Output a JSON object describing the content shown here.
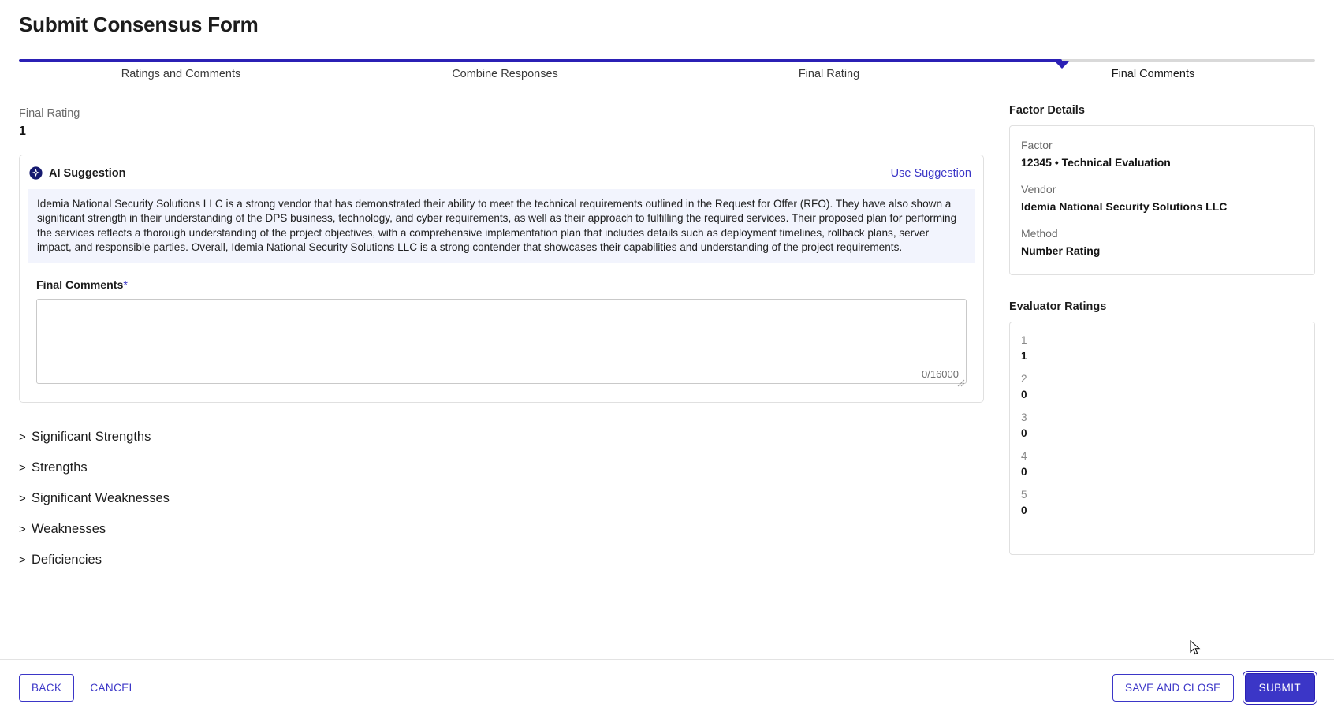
{
  "header": {
    "title": "Submit Consensus Form"
  },
  "stepper": {
    "steps": [
      {
        "label": "Ratings and Comments"
      },
      {
        "label": "Combine Responses"
      },
      {
        "label": "Final Rating"
      },
      {
        "label": "Final Comments"
      }
    ],
    "active_index": 3,
    "fill_percent": 80.5,
    "marker_percent": 80.5,
    "accent_color": "#2b20b5",
    "track_color": "#d9d9d9"
  },
  "main": {
    "final_rating_label": "Final Rating",
    "final_rating_value": "1",
    "ai": {
      "icon": "ai-sparkle-icon",
      "title": "AI Suggestion",
      "use_suggestion_label": "Use Suggestion",
      "link_color": "#3b36c7",
      "body_background": "#f2f4fd",
      "text": "Idemia National Security Solutions LLC is a strong vendor that has demonstrated their ability to meet the technical requirements outlined in the Request for Offer (RFO). They have also shown a significant strength in their understanding of the DPS business, technology, and cyber requirements, as well as their approach to fulfilling the required services. Their proposed plan for performing the services reflects a thorough understanding of the project objectives, with a comprehensive implementation plan that includes details such as deployment timelines, rollback plans, server impact, and responsible parties. Overall, Idemia National Security Solutions LLC is a strong contender that showcases their capabilities and understanding of the project requirements."
    },
    "final_comments": {
      "label": "Final Comments",
      "required_marker": "*",
      "value": "",
      "placeholder": "",
      "char_count": "0/16000"
    },
    "sections": [
      {
        "chevron": ">",
        "label": "Significant Strengths"
      },
      {
        "chevron": ">",
        "label": "Strengths"
      },
      {
        "chevron": ">",
        "label": "Significant Weaknesses"
      },
      {
        "chevron": ">",
        "label": "Weaknesses"
      },
      {
        "chevron": ">",
        "label": "Deficiencies"
      }
    ]
  },
  "sidebar": {
    "factor_details": {
      "heading": "Factor Details",
      "fields": [
        {
          "label": "Factor",
          "value": "12345 • Technical Evaluation"
        },
        {
          "label": "Vendor",
          "value": "Idemia National Security Solutions LLC"
        },
        {
          "label": "Method",
          "value": "Number Rating"
        }
      ]
    },
    "evaluator_ratings": {
      "heading": "Evaluator Ratings",
      "items": [
        {
          "key": "1",
          "value": "1"
        },
        {
          "key": "2",
          "value": "0"
        },
        {
          "key": "3",
          "value": "0"
        },
        {
          "key": "4",
          "value": "0"
        },
        {
          "key": "5",
          "value": "0"
        }
      ]
    }
  },
  "footer": {
    "back_label": "BACK",
    "cancel_label": "CANCEL",
    "save_and_close_label": "SAVE AND CLOSE",
    "submit_label": "SUBMIT"
  }
}
